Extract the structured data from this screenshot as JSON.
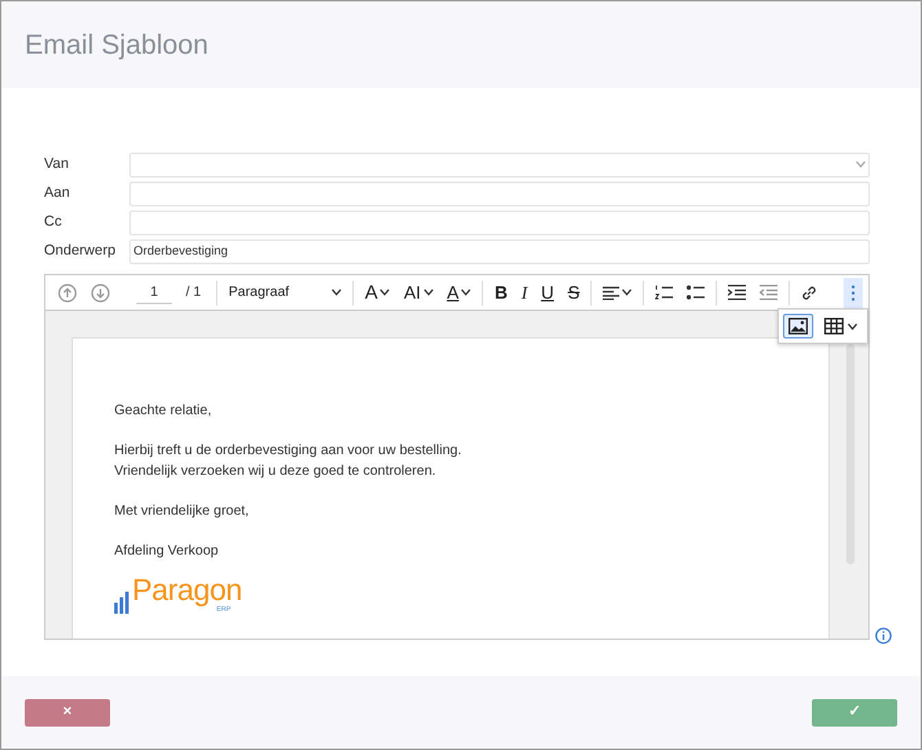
{
  "window": {
    "title": "Email Sjabloon"
  },
  "fields": [
    {
      "label": "Van",
      "kind": "select"
    },
    {
      "label": "Aan",
      "kind": "text"
    },
    {
      "label": "Cc",
      "kind": "text"
    },
    {
      "label": "Onderwerp",
      "kind": "text",
      "value": "Orderbevestiging"
    }
  ],
  "toolbar": {
    "page_current": "1",
    "page_total": "/ 1",
    "block_format": "Paragraaf",
    "font_size": "A",
    "line_height": "AI",
    "text_color": "A",
    "bold": "B",
    "italic": "I",
    "underline": "U",
    "strike": "S",
    "more_expanded": true,
    "popup": [
      {
        "kind": "image",
        "selected": true
      },
      {
        "kind": "table",
        "selected": false
      }
    ]
  },
  "body": {
    "paragraphs": [
      "Geachte relatie,",
      "Hierbij treft u de orderbevestiging aan voor uw bestelling.\nVriendelijk verzoeken wij u deze goed te controleren.",
      "Met vriendelijke groet,",
      "Afdeling Verkoop"
    ],
    "logo": {
      "name": "Paragon",
      "sub": "ERP"
    }
  },
  "buttons": [
    {
      "kind": "cancel",
      "label": "×"
    },
    {
      "kind": "ok",
      "label": "✓"
    }
  ]
}
